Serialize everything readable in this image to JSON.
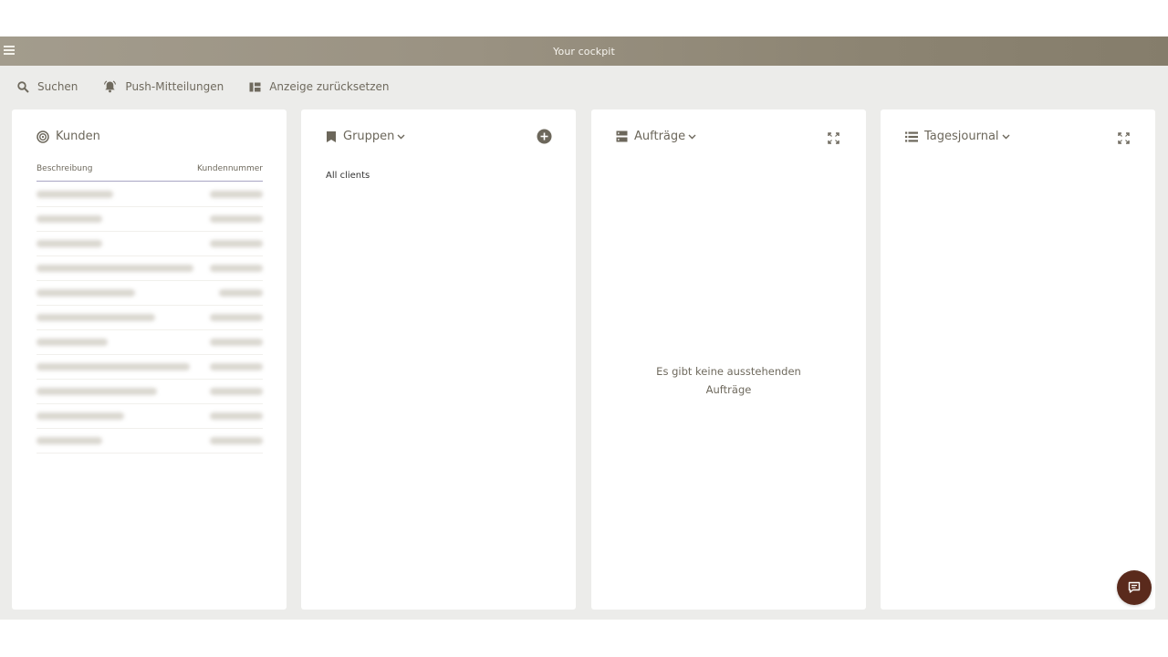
{
  "header": {
    "title": "Your cockpit"
  },
  "toolbar": {
    "search_label": "Suchen",
    "push_label": "Push-Mitteilungen",
    "reset_label": "Anzeige zurücksetzen"
  },
  "kunden": {
    "title": "Kunden",
    "col_description": "Beschreibung",
    "col_number": "Kundennummer",
    "row_count": 11
  },
  "gruppen": {
    "title": "Gruppen",
    "items": [
      "All clients"
    ]
  },
  "auftraege": {
    "title": "Aufträge",
    "empty_line1": "Es gibt keine ausstehenden",
    "empty_line2": "Aufträge"
  },
  "tagesjournal": {
    "title": "Tagesjournal"
  },
  "colors": {
    "accent": "#857d6b",
    "fab": "#5a2a1c",
    "background": "#ececea"
  }
}
